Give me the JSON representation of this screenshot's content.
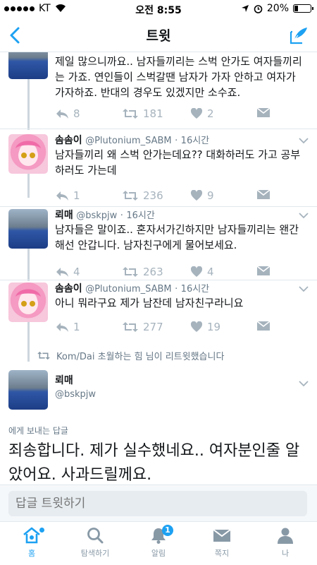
{
  "status_bar": {
    "carrier": "KT",
    "time": "오전 8:55",
    "battery": "20%"
  },
  "nav": {
    "title": "트윗"
  },
  "tweets": [
    {
      "text": "제일 많으니까요.. 남자들끼리는 스벅 안가도 여자들끼리는 가죠. 연인들이 스벅갈땐 남자가 가자 안하고 여자가 가자하죠. 반대의 경우도 있겠지만  소수죠.",
      "reply_count": "8",
      "retweet_count": "181",
      "like_count": "2"
    },
    {
      "name": "솜솜이",
      "handle": "@Plutonium_SABM",
      "time": "16시간",
      "text": "남자들끼리 왜 스벅 안가는데요?? 대화하러도 가고 공부하러도 가는데",
      "reply_count": "1",
      "retweet_count": "236",
      "like_count": "9"
    },
    {
      "name": "뢰매",
      "handle": "@bskpjw",
      "time": "16시간",
      "text": "남자들은 말이죠.. 혼자서가긴하지만 남자들끼리는 왠간해선 안갑니다. 남자친구에게 물어보세요.",
      "reply_count": "4",
      "retweet_count": "263",
      "like_count": "4"
    },
    {
      "name": "솜솜이",
      "handle": "@Plutonium_SABM",
      "time": "16시간",
      "text": "아니 뭐라구요 제가 남잔데 남자친구라니요",
      "reply_count": "1",
      "retweet_count": "277",
      "like_count": "19"
    }
  ],
  "retweet_notice": "Kom/Dai 초월하는 힘 님이 리트윗했습니다",
  "main_tweet": {
    "name": "뢰매",
    "handle": "@bskpjw",
    "reply_context": "에게 보내는 답글",
    "text": "죄송합니다.  제가 실수했네요.. 여자분인줄 알았어요. 사과드릴께요."
  },
  "reply_box": {
    "placeholder": "답글 트윗하기"
  },
  "tabs": [
    {
      "label": "홈",
      "icon": "home-icon"
    },
    {
      "label": "탐색하기",
      "icon": "search-icon"
    },
    {
      "label": "알림",
      "icon": "bell-icon",
      "badge": "1"
    },
    {
      "label": "쪽지",
      "icon": "envelope-icon"
    },
    {
      "label": "나",
      "icon": "person-icon"
    }
  ],
  "colors": {
    "accent": "#1da1f2",
    "muted": "#a6b3bd",
    "text": "#14171a"
  }
}
